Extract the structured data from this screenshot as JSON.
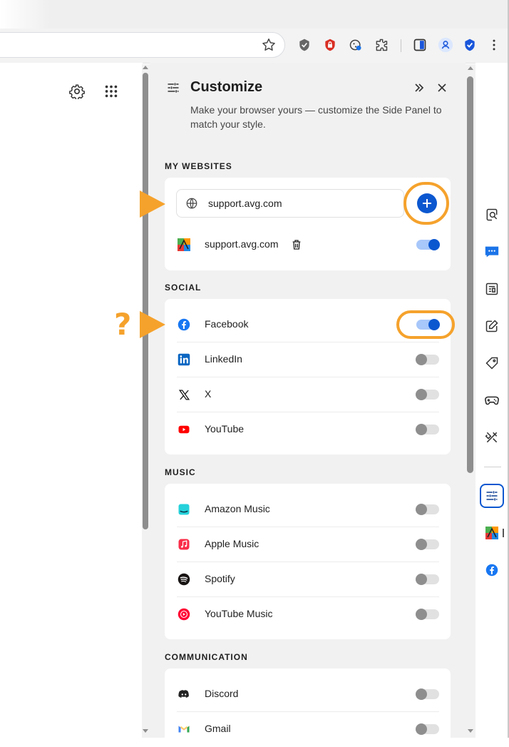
{
  "toolbar": {
    "icons": [
      "star-icon",
      "shield-check-icon",
      "lock-red-icon",
      "cookie-icon",
      "puzzle-icon",
      "side-panel-icon",
      "profile-icon",
      "shield-blue-icon",
      "more-icon"
    ]
  },
  "left_pane": {
    "icons": [
      "gear-icon",
      "apps-grid-icon"
    ]
  },
  "panel": {
    "title": "Customize",
    "subtitle": "Make your browser yours — customize the Side Panel to match your style.",
    "sections": [
      {
        "label": "MY WEBSITES",
        "input_value": "support.avg.com",
        "items": [
          {
            "label": "support.avg.com",
            "icon": "avg-logo-icon",
            "enabled": true
          }
        ]
      },
      {
        "label": "SOCIAL",
        "items": [
          {
            "label": "Facebook",
            "icon": "facebook-icon",
            "enabled": true
          },
          {
            "label": "LinkedIn",
            "icon": "linkedin-icon",
            "enabled": false
          },
          {
            "label": "X",
            "icon": "x-icon",
            "enabled": false
          },
          {
            "label": "YouTube",
            "icon": "youtube-icon",
            "enabled": false
          }
        ]
      },
      {
        "label": "MUSIC",
        "items": [
          {
            "label": "Amazon Music",
            "icon": "amazon-music-icon",
            "enabled": false
          },
          {
            "label": "Apple Music",
            "icon": "apple-music-icon",
            "enabled": false
          },
          {
            "label": "Spotify",
            "icon": "spotify-icon",
            "enabled": false
          },
          {
            "label": "YouTube Music",
            "icon": "youtube-music-icon",
            "enabled": false
          }
        ]
      },
      {
        "label": "COMMUNICATION",
        "items": [
          {
            "label": "Discord",
            "icon": "discord-icon",
            "enabled": false
          },
          {
            "label": "Gmail",
            "icon": "gmail-icon",
            "enabled": false
          }
        ]
      }
    ]
  },
  "annotation": {
    "question_mark": "?"
  },
  "colors": {
    "accent": "#0b57d0",
    "toggle_track_on": "#a8c7fa",
    "highlight": "#f5a22c",
    "panel_bg": "#f1f1f1"
  }
}
